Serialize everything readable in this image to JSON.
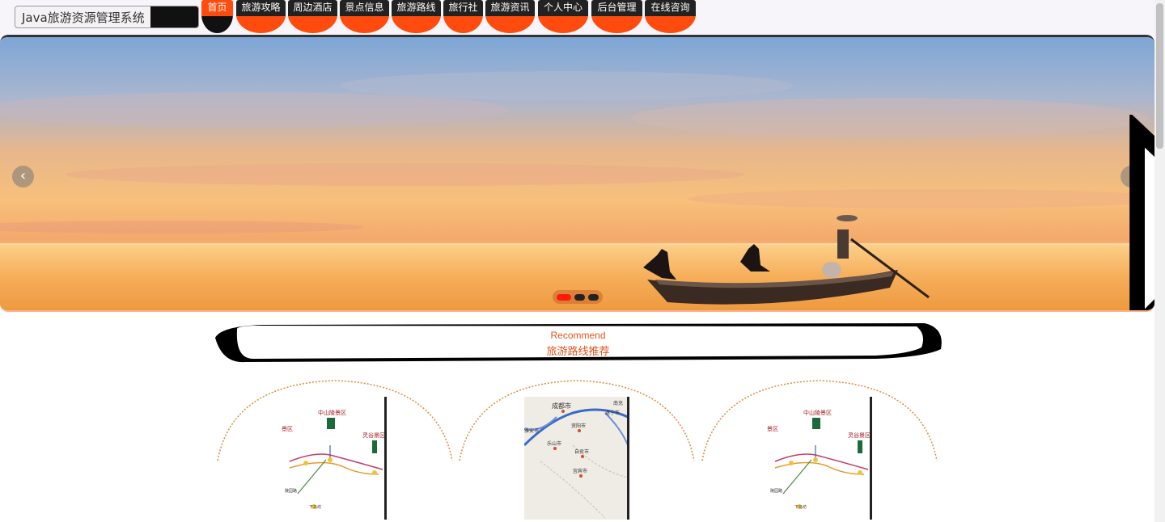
{
  "app": {
    "title": "Java旅游资源管理系统"
  },
  "nav": {
    "items": [
      {
        "label": "首页",
        "active": true
      },
      {
        "label": "旅游攻略"
      },
      {
        "label": "周边酒店"
      },
      {
        "label": "景点信息"
      },
      {
        "label": "旅游路线"
      },
      {
        "label": "旅行社"
      },
      {
        "label": "旅游资讯"
      },
      {
        "label": "个人中心"
      },
      {
        "label": "后台管理"
      },
      {
        "label": "在线咨询"
      }
    ]
  },
  "banner": {
    "prev_icon": "chevron-left-icon",
    "next_icon": "chevron-right-icon",
    "slides": 3,
    "active_slide": 1
  },
  "recommend": {
    "en_title": "Recommend",
    "cn_title": "旅游路线推荐"
  },
  "cards": [
    {
      "image": "scenic-map-zhongshanling"
    },
    {
      "image": "map-chengdu-region"
    },
    {
      "image": "scenic-map-zhongshanling"
    }
  ],
  "colors": {
    "accent": "#ff4b0d",
    "dark": "#222222",
    "title_text": "#e2541d"
  }
}
